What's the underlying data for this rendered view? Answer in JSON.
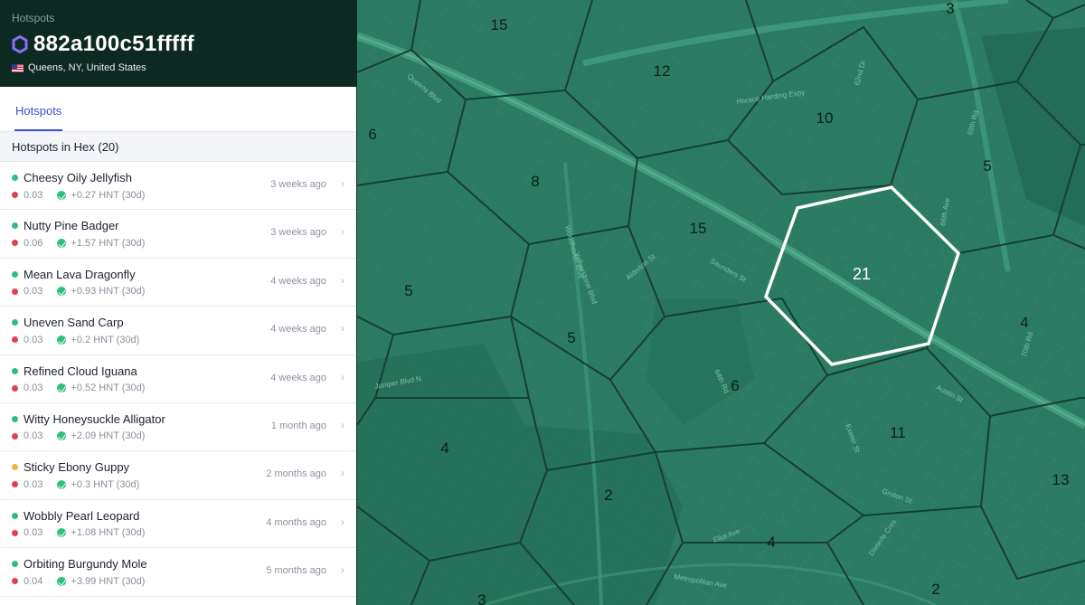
{
  "header": {
    "breadcrumb": "Hotspots",
    "hex_id": "882a100c51fffff",
    "location": "Queens, NY, United States"
  },
  "tabs": [
    {
      "label": "Hotspots",
      "active": true
    }
  ],
  "list": {
    "heading": "Hotspots in Hex (20)",
    "items": [
      {
        "name": "Cheesy Oily Jellyfish",
        "status": "online",
        "scale": "0.03",
        "rewards": "+0.27 HNT (30d)",
        "added": "3 weeks ago"
      },
      {
        "name": "Nutty Pine Badger",
        "status": "online",
        "scale": "0.06",
        "rewards": "+1.57 HNT (30d)",
        "added": "3 weeks ago"
      },
      {
        "name": "Mean Lava Dragonfly",
        "status": "online",
        "scale": "0.03",
        "rewards": "+0.93 HNT (30d)",
        "added": "4 weeks ago"
      },
      {
        "name": "Uneven Sand Carp",
        "status": "online",
        "scale": "0.03",
        "rewards": "+0.2 HNT (30d)",
        "added": "4 weeks ago"
      },
      {
        "name": "Refined Cloud Iguana",
        "status": "online",
        "scale": "0.03",
        "rewards": "+0.52 HNT (30d)",
        "added": "4 weeks ago"
      },
      {
        "name": "Witty Honeysuckle Alligator",
        "status": "online",
        "scale": "0.03",
        "rewards": "+2.09 HNT (30d)",
        "added": "1 month ago"
      },
      {
        "name": "Sticky Ebony Guppy",
        "status": "syncing",
        "scale": "0.03",
        "rewards": "+0.3 HNT (30d)",
        "added": "2 months ago"
      },
      {
        "name": "Wobbly Pearl Leopard",
        "status": "online",
        "scale": "0.03",
        "rewards": "+1.08 HNT (30d)",
        "added": "4 months ago"
      },
      {
        "name": "Orbiting Burgundy Mole",
        "status": "online",
        "scale": "0.04",
        "rewards": "+3.99 HNT (30d)",
        "added": "5 months ago"
      }
    ]
  },
  "colors": {
    "online": "#2fbf7c",
    "syncing": "#f2b63c",
    "scale_low": "#e0414a",
    "accent": "#3a4fd8",
    "header_bg": "#0d2a22",
    "map_bg": "#2b7b63"
  },
  "map": {
    "hex_counts": [
      "15",
      "3",
      "12",
      "10",
      "6",
      "5",
      "8",
      "15",
      "21",
      "5",
      "4",
      "5",
      "6",
      "11",
      "4",
      "13",
      "2",
      "4",
      "2",
      "3"
    ],
    "selected_count": "21",
    "street_labels": [
      "Queens Blvd",
      "Horace Harding Expy",
      "62nd Dr",
      "Yellowstone Blvd",
      "Saunders St",
      "Austin St",
      "Woodhaven Blvd",
      "Alderton St",
      "Juniper Blvd N",
      "Metropolitan Ave",
      "Groton St",
      "64th Rd",
      "Exeter St",
      "70th Rd",
      "66th Ave",
      "Dieterle Cres",
      "Eliot Ave",
      "69th Rd"
    ]
  }
}
